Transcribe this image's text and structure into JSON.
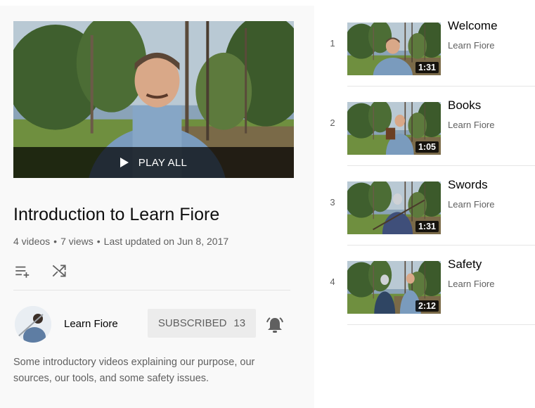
{
  "playlist": {
    "play_all_label": "PLAY ALL",
    "title": "Introduction to Learn Fiore",
    "stats": {
      "videos": "4 videos",
      "views": "7 views",
      "updated": "Last updated on Jun 8, 2017"
    },
    "actions": {
      "save_icon": "add-to-queue-icon",
      "shuffle_icon": "shuffle-icon"
    },
    "owner": {
      "name": "Learn Fiore",
      "subscribe_label": "SUBSCRIBED",
      "subscriber_count": "13",
      "bell_icon": "notification-bell-icon"
    },
    "description": "Some introductory videos explaining our purpose, our sources, our tools, and some safety issues."
  },
  "videos": [
    {
      "index": "1",
      "title": "Welcome",
      "channel": "Learn Fiore",
      "duration": "1:31"
    },
    {
      "index": "2",
      "title": "Books",
      "channel": "Learn Fiore",
      "duration": "1:05"
    },
    {
      "index": "3",
      "title": "Swords",
      "channel": "Learn Fiore",
      "duration": "1:31"
    },
    {
      "index": "4",
      "title": "Safety",
      "channel": "Learn Fiore",
      "duration": "2:12"
    }
  ],
  "colors": {
    "panel_bg": "#f9f9f9",
    "subscribe_bg": "#ececec",
    "text_primary": "#030303",
    "text_secondary": "#606060"
  }
}
